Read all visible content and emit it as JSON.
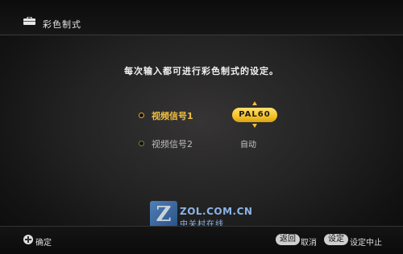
{
  "header": {
    "title": "彩色制式",
    "icon": "toolbox-icon"
  },
  "instruction": "每次输入都可进行彩色制式的设定。",
  "settings": [
    {
      "label": "视频信号1",
      "value": "PAL60",
      "selected": true
    },
    {
      "label": "视频信号2",
      "value": "自动",
      "selected": false
    }
  ],
  "watermark": {
    "logo_letter": "Z",
    "line1": "ZOL.COM.CN",
    "line2": "中关村在线"
  },
  "footer": {
    "confirm_label": "确定",
    "back_key": "返回",
    "back_label": "取消",
    "setup_key": "设定",
    "setup_label": "设定中止"
  },
  "colors": {
    "accent": "#f0c040",
    "background": "#232323"
  }
}
